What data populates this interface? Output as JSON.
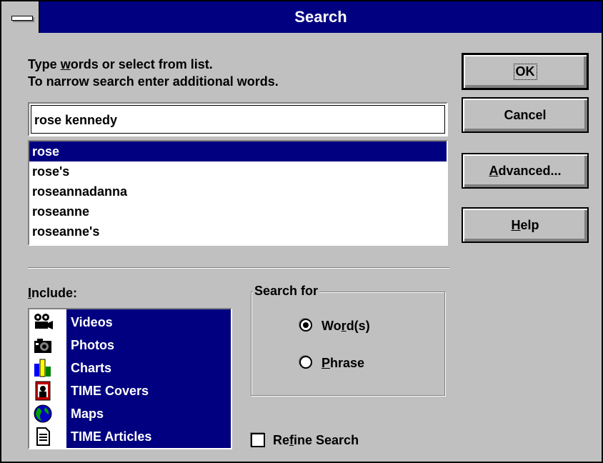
{
  "window": {
    "title": "Search"
  },
  "instructions": {
    "line1_pre": "Type ",
    "line1_u": "w",
    "line1_post": "ords or select from list.",
    "line2": "To narrow search enter additional words."
  },
  "search": {
    "value": "rose kennedy"
  },
  "word_list": {
    "selected_index": 0,
    "items": [
      "rose",
      "rose's",
      "roseannadanna",
      "roseanne",
      "roseanne's"
    ]
  },
  "buttons": {
    "ok": "OK",
    "cancel": "Cancel",
    "advanced_u": "A",
    "advanced_rest": "dvanced...",
    "help_u": "H",
    "help_rest": "elp"
  },
  "include": {
    "label_u": "I",
    "label_rest": "nclude:",
    "items": [
      {
        "label": "Videos",
        "icon": "video-camera-icon"
      },
      {
        "label": "Photos",
        "icon": "camera-icon"
      },
      {
        "label": "Charts",
        "icon": "bar-chart-icon"
      },
      {
        "label": "TIME Covers",
        "icon": "magazine-cover-icon"
      },
      {
        "label": "Maps",
        "icon": "globe-icon"
      },
      {
        "label": "TIME Articles",
        "icon": "document-icon"
      }
    ]
  },
  "search_for": {
    "title": "Search for",
    "options": [
      {
        "pre": "Wo",
        "u": "r",
        "post": "d(s)",
        "selected": true
      },
      {
        "pre": "",
        "u": "P",
        "post": "hrase",
        "selected": false
      }
    ]
  },
  "refine": {
    "pre": "Re",
    "u": "f",
    "post": "ine Search",
    "checked": false
  },
  "colors": {
    "titlebar": "#000080",
    "face": "#c0c0c0",
    "selection": "#000080"
  }
}
